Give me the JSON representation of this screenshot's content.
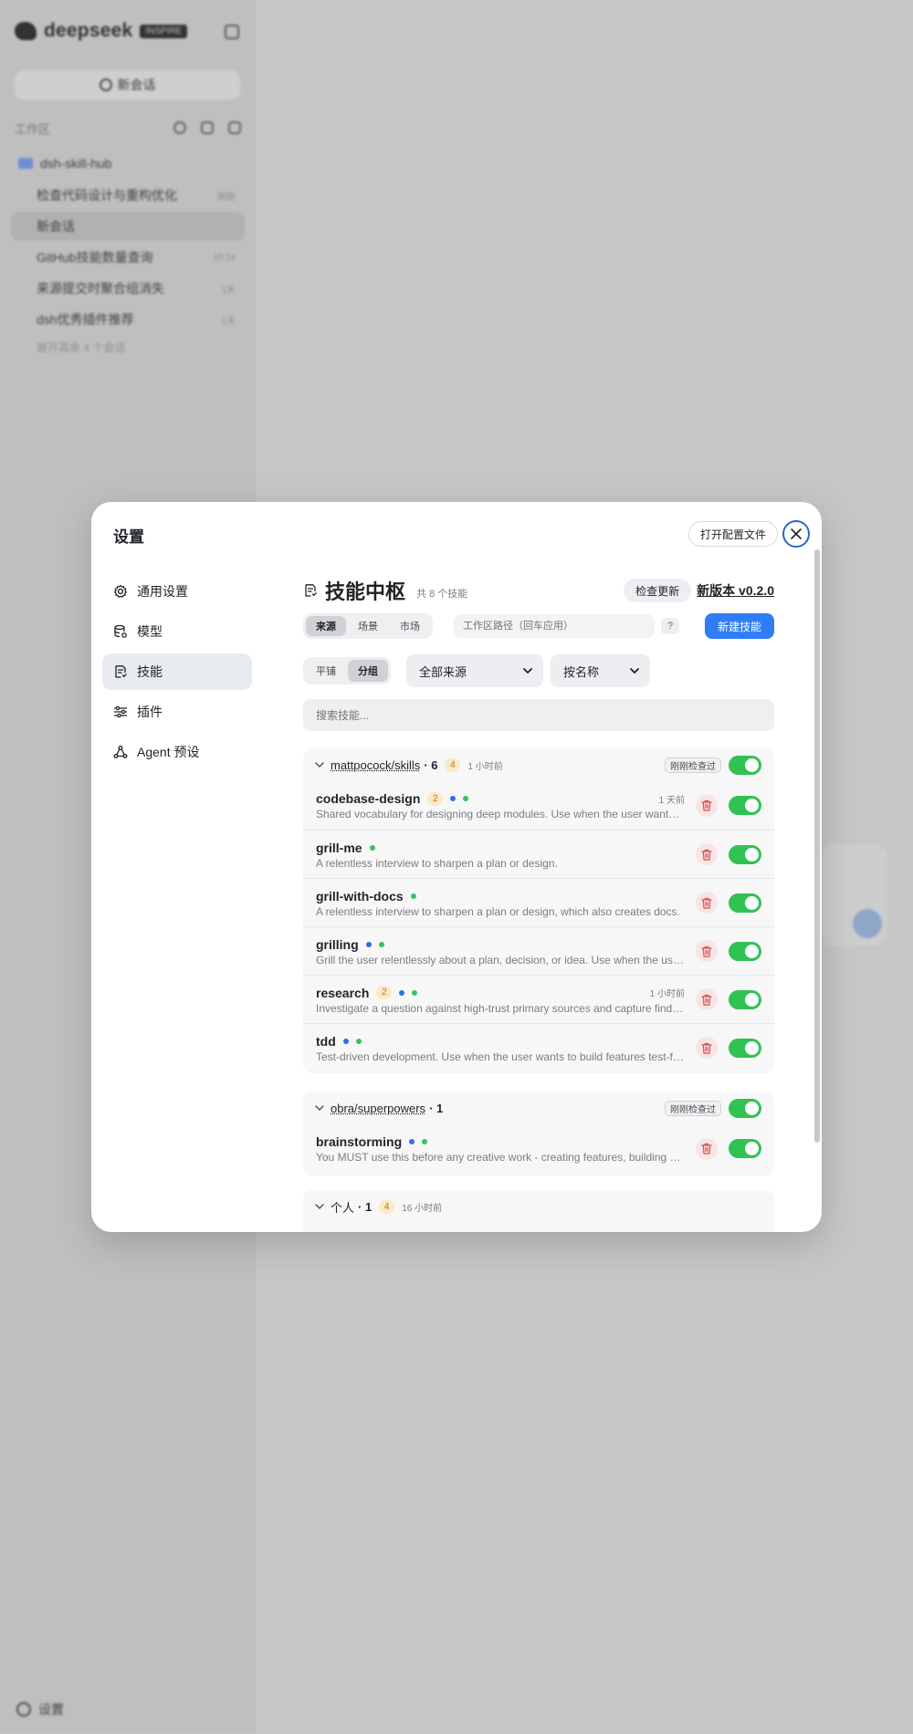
{
  "app": {
    "logo_text": "deepseek",
    "logo_badge": "INSPIRE",
    "new_chat_label": "新会话",
    "workspace_label": "工作区",
    "folder_name": "dsh-skill-hub",
    "conversations": [
      {
        "title": "检查代码设计与重构优化",
        "time": "刚刚"
      },
      {
        "title": "新会话",
        "time": ""
      },
      {
        "title": "GitHub技能数量查询",
        "time": "10:14"
      },
      {
        "title": "来源提交时聚合组消失",
        "time": "1天"
      },
      {
        "title": "dsh优秀插件推荐",
        "time": "1天"
      }
    ],
    "more_label": "展开其余 4 个会话",
    "settings_label": "设置"
  },
  "modal": {
    "title": "设置",
    "open_config_label": "打开配置文件",
    "nav": [
      {
        "label": "通用设置",
        "icon": "gear-icon"
      },
      {
        "label": "模型",
        "icon": "database-icon"
      },
      {
        "label": "技能",
        "icon": "skill-doc-icon"
      },
      {
        "label": "插件",
        "icon": "sliders-icon"
      },
      {
        "label": "Agent 预设",
        "icon": "agent-icon"
      }
    ]
  },
  "hub": {
    "title": "技能中枢",
    "count": "共 8 个技能",
    "check_update_label": "检查更新",
    "new_version_label": "新版本 v0.2.0",
    "tabs": [
      "来源",
      "场景",
      "市场"
    ],
    "workspace_placeholder": "工作区路径（回车应用）",
    "help_label": "?",
    "new_skill_label": "新建技能",
    "view_modes": [
      "平铺",
      "分组"
    ],
    "source_select": "全部来源",
    "sort_select": "按名称",
    "search_placeholder": "搜索技能..."
  },
  "groups": [
    {
      "name": "mattpocock/skills",
      "count": "· 6",
      "badge": "4",
      "time": "1 小时前",
      "checked": "刚刚检查过",
      "skills": [
        {
          "name": "codebase-design",
          "badge": "2",
          "time": "1 天前",
          "desc": "Shared vocabulary for designing deep modules. Use when the user wants to improve architecture."
        },
        {
          "name": "grill-me",
          "time": "",
          "desc": "A relentless interview to sharpen a plan or design."
        },
        {
          "name": "grill-with-docs",
          "time": "",
          "desc": "A relentless interview to sharpen a plan or design, which also creates docs."
        },
        {
          "name": "grilling",
          "time": "",
          "desc": "Grill the user relentlessly about a plan, decision, or idea. Use when the user wants."
        },
        {
          "name": "research",
          "badge": "2",
          "time": "1 小时前",
          "desc": "Investigate a question against high-trust primary sources and capture findings."
        },
        {
          "name": "tdd",
          "time": "",
          "desc": "Test-driven development. Use when the user wants to build features test-first."
        }
      ]
    },
    {
      "name": "obra/superpowers",
      "count": "· 1",
      "checked": "刚刚检查过",
      "skills": [
        {
          "name": "brainstorming",
          "time": "",
          "desc": "You MUST use this before any creative work - creating features, building components."
        }
      ]
    },
    {
      "name": "个人",
      "count": "· 1",
      "badge": "4",
      "time": "16 小时前"
    }
  ],
  "colors": {
    "accent": "#2f7df6",
    "toggle_on": "#30c253",
    "dot_blue": "#2f6ee8",
    "dot_green": "#35c25a",
    "badge_orange_bg": "#fbe8c5"
  }
}
